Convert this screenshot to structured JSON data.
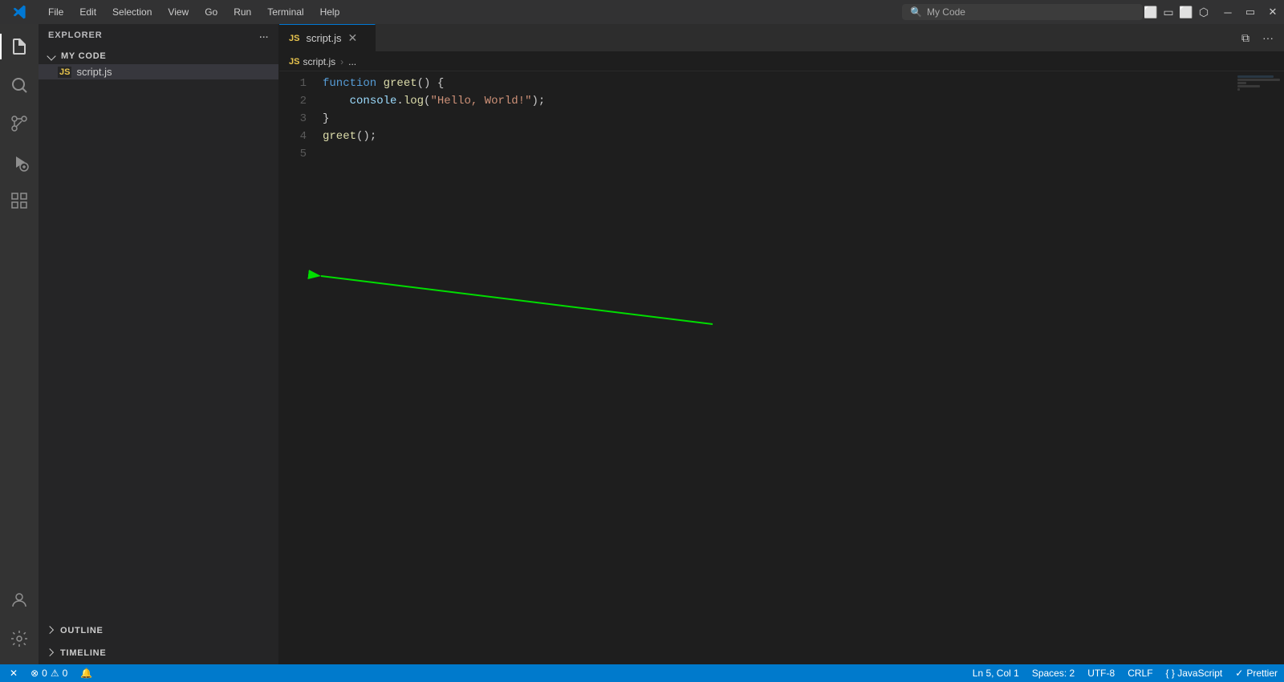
{
  "titlebar": {
    "menu_items": [
      "File",
      "Edit",
      "Selection",
      "View",
      "Go",
      "Run",
      "Terminal",
      "Help"
    ],
    "search_placeholder": "My Code",
    "window_controls": [
      "minimize",
      "restore",
      "close"
    ]
  },
  "activity_bar": {
    "items": [
      {
        "name": "explorer",
        "icon": "files-icon",
        "active": true
      },
      {
        "name": "search",
        "icon": "search-icon",
        "active": false
      },
      {
        "name": "source-control",
        "icon": "source-control-icon",
        "active": false
      },
      {
        "name": "run-debug",
        "icon": "run-icon",
        "active": false
      },
      {
        "name": "extensions",
        "icon": "extensions-icon",
        "active": false
      }
    ],
    "bottom_items": [
      {
        "name": "account",
        "icon": "account-icon"
      },
      {
        "name": "settings",
        "icon": "settings-icon"
      }
    ]
  },
  "sidebar": {
    "title": "EXPLORER",
    "more_actions_label": "...",
    "folder": {
      "name": "MY CODE",
      "expanded": true
    },
    "files": [
      {
        "name": "script.js",
        "type": "js",
        "active": true
      }
    ],
    "bottom_sections": [
      {
        "name": "OUTLINE",
        "expanded": false
      },
      {
        "name": "TIMELINE",
        "expanded": false
      }
    ]
  },
  "editor": {
    "tabs": [
      {
        "name": "script.js",
        "active": true,
        "modified": false
      }
    ],
    "breadcrumb": {
      "file": "script.js",
      "symbol": "..."
    },
    "code_lines": [
      {
        "number": 1,
        "tokens": [
          {
            "type": "kw",
            "text": "function"
          },
          {
            "type": "plain",
            "text": " "
          },
          {
            "type": "fn",
            "text": "greet"
          },
          {
            "type": "punc",
            "text": "() {"
          }
        ]
      },
      {
        "number": 2,
        "tokens": [
          {
            "type": "plain",
            "text": "    "
          },
          {
            "type": "obj",
            "text": "console"
          },
          {
            "type": "punc",
            "text": "."
          },
          {
            "type": "fn",
            "text": "log"
          },
          {
            "type": "punc",
            "text": "("
          },
          {
            "type": "str",
            "text": "\"Hello, World!\""
          },
          {
            "type": "punc",
            "text": ");"
          }
        ]
      },
      {
        "number": 3,
        "tokens": [
          {
            "type": "punc",
            "text": "}"
          }
        ]
      },
      {
        "number": 4,
        "tokens": [
          {
            "type": "fn",
            "text": "greet"
          },
          {
            "type": "punc",
            "text": "();"
          }
        ]
      },
      {
        "number": 5,
        "tokens": []
      }
    ]
  },
  "status_bar": {
    "left_items": [
      {
        "icon": "x-icon",
        "text": ""
      },
      {
        "icon": "error-icon",
        "text": "0"
      },
      {
        "icon": "warning-icon",
        "text": "0"
      },
      {
        "icon": "bell-icon",
        "text": ""
      }
    ],
    "right_items": [
      {
        "label": "Ln 5, Col 1"
      },
      {
        "label": "Spaces: 2"
      },
      {
        "label": "UTF-8"
      },
      {
        "label": "CRLF"
      },
      {
        "label": "{ } JavaScript"
      },
      {
        "label": "✓ Prettier"
      }
    ]
  },
  "colors": {
    "titlebar_bg": "#323233",
    "activity_bg": "#333333",
    "sidebar_bg": "#252526",
    "editor_bg": "#1e1e1e",
    "tab_active_bg": "#1e1e1e",
    "tab_inactive_bg": "#2d2d2d",
    "status_bg": "#007acc",
    "accent": "#0078d4",
    "green_arrow": "#00dd00"
  }
}
